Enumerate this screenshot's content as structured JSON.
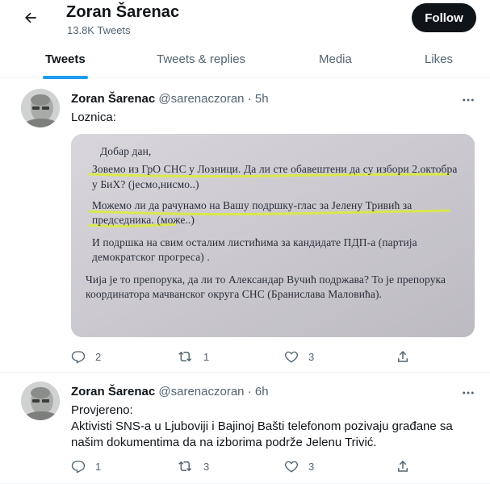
{
  "header": {
    "profile_name": "Zoran Šarenac",
    "tweet_count": "13.8K Tweets",
    "follow_label": "Follow"
  },
  "tabs": [
    {
      "label": "Tweets",
      "active": true
    },
    {
      "label": "Tweets & replies",
      "active": false
    },
    {
      "label": "Media",
      "active": false
    },
    {
      "label": "Likes",
      "active": false
    }
  ],
  "tweets": [
    {
      "author_name": "Zoran Šarenac",
      "handle": "@sarenaczoran",
      "separator": "·",
      "time": "5h",
      "text_lines": [
        "Loznica:"
      ],
      "media": {
        "kind": "photo of a printed letter",
        "lines": [
          "Добар дан,",
          "Зовемо из ГрО СНС у Лозници. Да ли сте обавештени да су избори 2.октобра",
          "у БиХ? (јесмо,нисмо..)",
          "Можемо ли да рачунамо на Вашу подршку-глас за Јелену Тривић за",
          "председника. (може..)",
          "И подршка на свим осталим листићима за кандидате ПДП-а (партија",
          "демократског прогреса) .",
          "Чија је то препорука, да ли то Александар Вучић подржава? То је препорука",
          "координатора мачванског округа СНС (Бранислава Маловића)."
        ],
        "highlight_color": "#d9ea3c"
      },
      "actions": {
        "replies": "2",
        "retweets": "1",
        "likes": "3"
      }
    },
    {
      "author_name": "Zoran Šarenac",
      "handle": "@sarenaczoran",
      "separator": "·",
      "time": "6h",
      "text_lines": [
        "Provjereno:",
        "Aktivisti SNS-a u Ljuboviji i Bajinoj Bašti telefonom pozivaju građane sa",
        "našim dokumentima da na izborima podrže Jelenu Trivić."
      ],
      "actions": {
        "replies": "1",
        "retweets": "3",
        "likes": "3"
      }
    }
  ],
  "colors": {
    "accent": "#1d9bf0",
    "text_primary": "#0f1419",
    "text_secondary": "#536471",
    "follow_bg": "#0f1419"
  },
  "icons": {
    "back": "arrow-left-icon",
    "more": "more-horizontal-icon",
    "reply": "reply-icon",
    "retweet": "retweet-icon",
    "like": "heart-icon",
    "share": "share-icon"
  }
}
